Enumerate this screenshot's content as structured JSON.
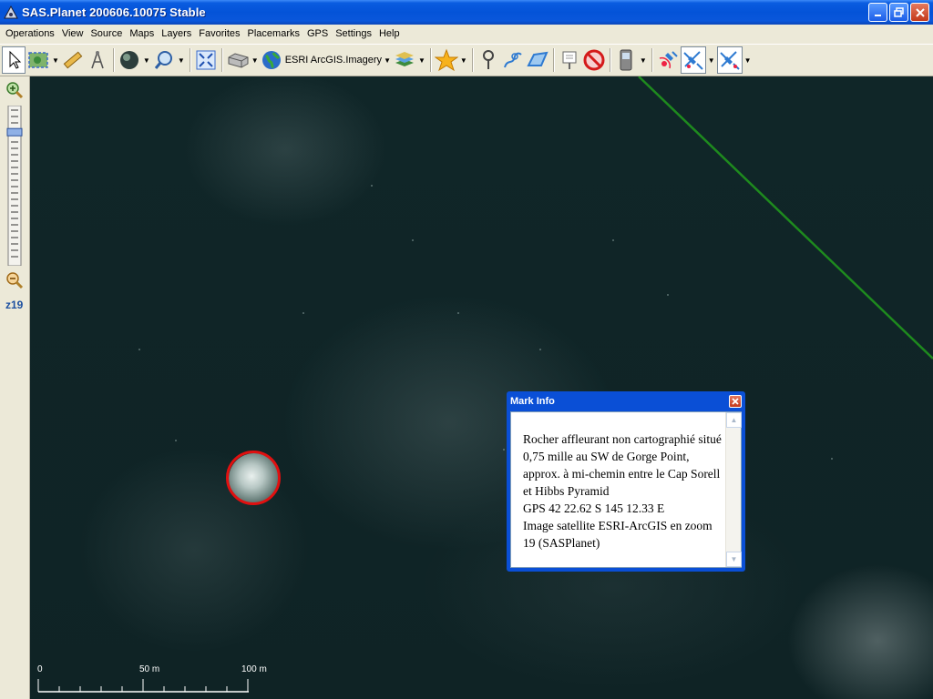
{
  "window": {
    "title": "SAS.Planet 200606.10075 Stable"
  },
  "menu": [
    "Operations",
    "View",
    "Source",
    "Maps",
    "Layers",
    "Favorites",
    "Placemarks",
    "GPS",
    "Settings",
    "Help"
  ],
  "toolbar": {
    "map_source_label": "ESRI ArcGIS.Imagery"
  },
  "zoom": {
    "level_label": "z19",
    "slider_position": 0.15
  },
  "scale_bar": {
    "labels": [
      "0",
      "50 m",
      "100 m"
    ]
  },
  "mark_info": {
    "title": "Mark Info",
    "text": "Rocher affleurant non cartographié situé 0,75 mille au SW de Gorge Point, approx. à mi-chemin entre le Cap Sorell et Hibbs Pyramid\nGPS 42 22.62 S 145 12.33 E\nImage satellite ESRI-ArcGIS en zoom 19 (SASPlanet)"
  },
  "colors": {
    "accent": "#0a4fd6",
    "track_line": "#1e8a1e",
    "marker_ring": "#e01010"
  }
}
